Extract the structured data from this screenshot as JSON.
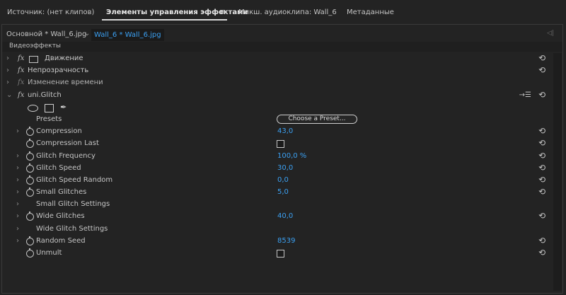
{
  "tabs": [
    {
      "label": "Источник: (нет клипов)"
    },
    {
      "label": "Элементы управления эффектами"
    },
    {
      "label": "Микш. аудиоклипа: Wall_6"
    },
    {
      "label": "Метаданные"
    }
  ],
  "tab_menu_icon": "≡",
  "clip_header": {
    "master": "Основной * Wall_6.jpg",
    "active_clip": "Wall_6 * Wall_6.jpg"
  },
  "section_label": "Видеоэффекты",
  "effects": {
    "motion": "Движение",
    "opacity": "Непрозрачность",
    "time_remap": "Изменение времени",
    "glitch": "uni.Glitch"
  },
  "fx_badge": "fx",
  "glitch": {
    "presets_label": "Presets",
    "preset_button": "Choose a Preset...",
    "params": [
      {
        "name": "Compression",
        "value": "43,0"
      },
      {
        "name": "Compression Last",
        "checkbox": true
      },
      {
        "name": "Glitch Frequency",
        "value": "100,0 %"
      },
      {
        "name": "Glitch Speed",
        "value": "30,0"
      },
      {
        "name": "Glitch Speed Random",
        "value": "0,0"
      },
      {
        "name": "Small Glitches",
        "value": "5,0"
      },
      {
        "name": "Small Glitch Settings"
      },
      {
        "name": "Wide Glitches",
        "value": "40,0"
      },
      {
        "name": "Wide Glitch Settings"
      },
      {
        "name": "Random Seed",
        "value": "8539"
      },
      {
        "name": "Unmult",
        "checkbox": true
      }
    ]
  },
  "icons": {
    "reset": "reset-icon",
    "stopwatch": "stopwatch-icon",
    "disclosure": "chevron-right-icon"
  },
  "colors": {
    "background": "#232323",
    "value_blue": "#3ba0f2",
    "text": "#bdbdbd"
  }
}
